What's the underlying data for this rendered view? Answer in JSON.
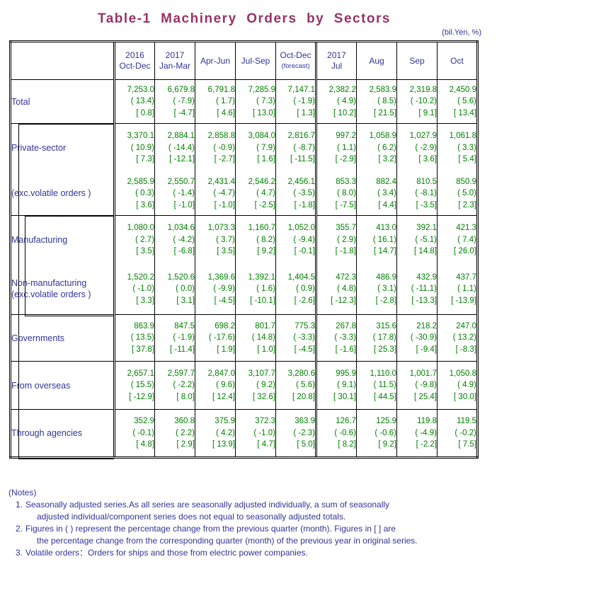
{
  "title": "Table-1  Machinery  Orders  by  Sectors",
  "unit_note": "(bil.Yen, %)",
  "header": {
    "blank_label": "",
    "columns": [
      {
        "year": "2016",
        "period": "Oct-Dec",
        "sub": ""
      },
      {
        "year": "2017",
        "period": "Jan-Mar",
        "sub": ""
      },
      {
        "year": "",
        "period": "Apr-Jun",
        "sub": ""
      },
      {
        "year": "",
        "period": "Jul-Sep",
        "sub": ""
      },
      {
        "year": "",
        "period": "Oct-Dec",
        "sub": "(forecast)"
      },
      {
        "year": "2017",
        "period": "Jul",
        "sub": ""
      },
      {
        "year": "",
        "period": "Aug",
        "sub": ""
      },
      {
        "year": "",
        "period": "Sep",
        "sub": ""
      },
      {
        "year": "",
        "period": "Oct",
        "sub": ""
      }
    ]
  },
  "rows": [
    {
      "label": "Total",
      "label2": "",
      "values": [
        "7,253.0",
        "6,679.8",
        "6,791.8",
        "7,285.9",
        "7,147.1",
        "2,382.2",
        "2,583.9",
        "2,319.8",
        "2,450.9"
      ],
      "pct_prev": [
        "( 13.4)",
        "( -7.9)",
        "( 1.7)",
        "( 7.3)",
        "( -1.9)",
        "( 4.9)",
        "( 8.5)",
        "( -10.2)",
        "( 5.6)"
      ],
      "pct_year": [
        "[ 0.8]",
        "[ -4.7]",
        "[ 4.6]",
        "[ 13.0]",
        "[ 1.3]",
        "[ 10.2]",
        "[ 21.5]",
        "[ 9.1]",
        "[ 13.4]"
      ]
    },
    {
      "label": "Private-sector",
      "label2": "",
      "values": [
        "3,370.1",
        "2,884.1",
        "2,858.8",
        "3,084.0",
        "2,816.7",
        "997.2",
        "1,058.9",
        "1,027.9",
        "1,061.8"
      ],
      "pct_prev": [
        "( 10.9)",
        "( -14.4)",
        "( -0.9)",
        "( 7.9)",
        "( -8.7)",
        "( 1.1)",
        "( 6.2)",
        "( -2.9)",
        "( 3.3)"
      ],
      "pct_year": [
        "[ 7.3]",
        "[ -12.1]",
        "[ -2.7]",
        "[ 1.6]",
        "[ -11.5]",
        "[ -2.9]",
        "[ 3.2]",
        "[ 3.6]",
        "[ 5.4]"
      ]
    },
    {
      "label": "(exc.volatile orders )",
      "label2": "",
      "values": [
        "2,585.9",
        "2,550.7",
        "2,431.4",
        "2,546.2",
        "2,456.1",
        "853.3",
        "882.4",
        "810.5",
        "850.9"
      ],
      "pct_prev": [
        "( 0.3)",
        "( -1.4)",
        "( -4.7)",
        "( 4.7)",
        "( -3.5)",
        "( 8.0)",
        "( 3.4)",
        "( -8.1)",
        "( 5.0)"
      ],
      "pct_year": [
        "[ 3.6]",
        "[ -1.0]",
        "[ -1.0]",
        "[ -2.5]",
        "[ -1.8]",
        "[ -7.5]",
        "[ 4.4]",
        "[ -3.5]",
        "[ 2.3]"
      ]
    },
    {
      "label": "Manufacturing",
      "label2": "",
      "values": [
        "1,080.0",
        "1,034.6",
        "1,073.3",
        "1,160.7",
        "1,052.0",
        "355.7",
        "413.0",
        "392.1",
        "421.3"
      ],
      "pct_prev": [
        "( 2.7)",
        "( -4.2)",
        "( 3.7)",
        "( 8.2)",
        "( -9.4)",
        "( 2.9)",
        "( 16.1)",
        "( -5.1)",
        "( 7.4)"
      ],
      "pct_year": [
        "[ 3.5]",
        "[ -6.8]",
        "[ 3.5]",
        "[ 9.2]",
        "[ -0.1]",
        "[ -1.8]",
        "[ 14.7]",
        "[ 14.8]",
        "[ 26.0]"
      ]
    },
    {
      "label": "Non-manufacturing",
      "label2": "(exc.volatile orders )",
      "values": [
        "1,520.2",
        "1,520.6",
        "1,369.6",
        "1,392.1",
        "1,404.5",
        "472.3",
        "486.9",
        "432.9",
        "437.7"
      ],
      "pct_prev": [
        "( -1.0)",
        "( 0.0)",
        "( -9.9)",
        "( 1.6)",
        "( 0.9)",
        "( 4.8)",
        "( 3.1)",
        "( -11.1)",
        "( 1.1)"
      ],
      "pct_year": [
        "[ 3.3]",
        "[ 3.1]",
        "[ -4.5]",
        "[ -10.1]",
        "[ -2.6]",
        "[ -12.3]",
        "[ -2.8]",
        "[ -13.3]",
        "[ -13.9]"
      ]
    },
    {
      "label": "Governments",
      "label2": "",
      "values": [
        "863.9",
        "847.5",
        "698.2",
        "801.7",
        "775.3",
        "267.8",
        "315.6",
        "218.2",
        "247.0"
      ],
      "pct_prev": [
        "( 13.5)",
        "( -1.9)",
        "( -17.6)",
        "( 14.8)",
        "( -3.3)",
        "( -3.3)",
        "( 17.8)",
        "( -30.9)",
        "( 13.2)"
      ],
      "pct_year": [
        "[ 37.8]",
        "[ -11.4]",
        "[ 1.9]",
        "[ 1.0]",
        "[ -4.5]",
        "[ -1.6]",
        "[ 25.3]",
        "[ -9.4]",
        "[ -8.3]"
      ]
    },
    {
      "label": "From overseas",
      "label2": "",
      "values": [
        "2,657.1",
        "2,597.7",
        "2,847.0",
        "3,107.7",
        "3,280.6",
        "995.9",
        "1,110.0",
        "1,001.7",
        "1,050.8"
      ],
      "pct_prev": [
        "( 15.5)",
        "( -2.2)",
        "( 9.6)",
        "( 9.2)",
        "( 5.6)",
        "( 9.1)",
        "( 11.5)",
        "( -9.8)",
        "( 4.9)"
      ],
      "pct_year": [
        "[ -12.9]",
        "[ 8.0]",
        "[ 12.4]",
        "[ 32.6]",
        "[ 20.8]",
        "[ 30.1]",
        "[ 44.5]",
        "[ 25.4]",
        "[ 30.0]"
      ]
    },
    {
      "label": "Through agencies",
      "label2": "",
      "values": [
        "352.9",
        "360.8",
        "375.9",
        "372.3",
        "363.9",
        "126.7",
        "125.9",
        "119.8",
        "119.5"
      ],
      "pct_prev": [
        "( -0.1)",
        "( 2.2)",
        "( 4.2)",
        "( -1.0)",
        "( -2.3)",
        "( -0.6)",
        "( -0.6)",
        "( -4.9)",
        "( -0.2)"
      ],
      "pct_year": [
        "[ 4.8]",
        "[ 2.9]",
        "[ 13.9]",
        "[ 4.7]",
        "[ 5.0]",
        "[ 8.2]",
        "[ 9.2]",
        "[ -2.2]",
        "[ 7.5]"
      ]
    }
  ],
  "notes": {
    "heading": "(Notes)",
    "items": [
      {
        "num": "1.",
        "line1": "Seasonally adjusted series.As all series are seasonally adjusted individually, a sum of seasonally",
        "line2": "adjusted individual/component series does not equal to seasonally adjusted totals."
      },
      {
        "num": "2.",
        "line1": "Figures in ( ) represent the percentage change from the previous quarter (month). Figures in [ ] are",
        "line2": "the percentage change from the corresponding quarter (month) of the previous year in original series."
      },
      {
        "num": "3.",
        "line1": "Volatile orders：Orders for ships and those from electric power companies.",
        "line2": ""
      }
    ]
  },
  "colors": {
    "title": "#993366",
    "label": "#333399",
    "value": "#008000",
    "border": "#000000"
  }
}
